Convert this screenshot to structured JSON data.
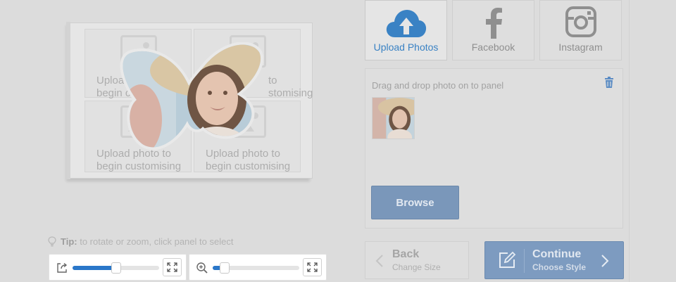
{
  "sources": {
    "upload_label": "Upload Photos",
    "facebook_label": "Facebook",
    "instagram_label": "Instagram",
    "active": "upload",
    "accent_color": "#3a82c4"
  },
  "canvas": {
    "placeholder_text_line1": "Upload photo to",
    "placeholder_text_line2": "begin customising",
    "top_left_line1": "Uploa",
    "top_left_line2": "begin c",
    "top_right_line1": "to",
    "top_right_line2": "stomising"
  },
  "tip": {
    "label": "Tip:",
    "text": "to rotate or zoom, click panel to select"
  },
  "sliders": {
    "rotate_value": 0.5,
    "zoom_value": 0.14,
    "fill_color": "#2a77c9"
  },
  "drop_panel": {
    "instruction": "Drag and drop photo on to panel",
    "browse_label": "Browse"
  },
  "nav": {
    "back_title": "Back",
    "back_subtitle": "Change Size",
    "continue_title": "Continue",
    "continue_subtitle": "Choose Style"
  }
}
